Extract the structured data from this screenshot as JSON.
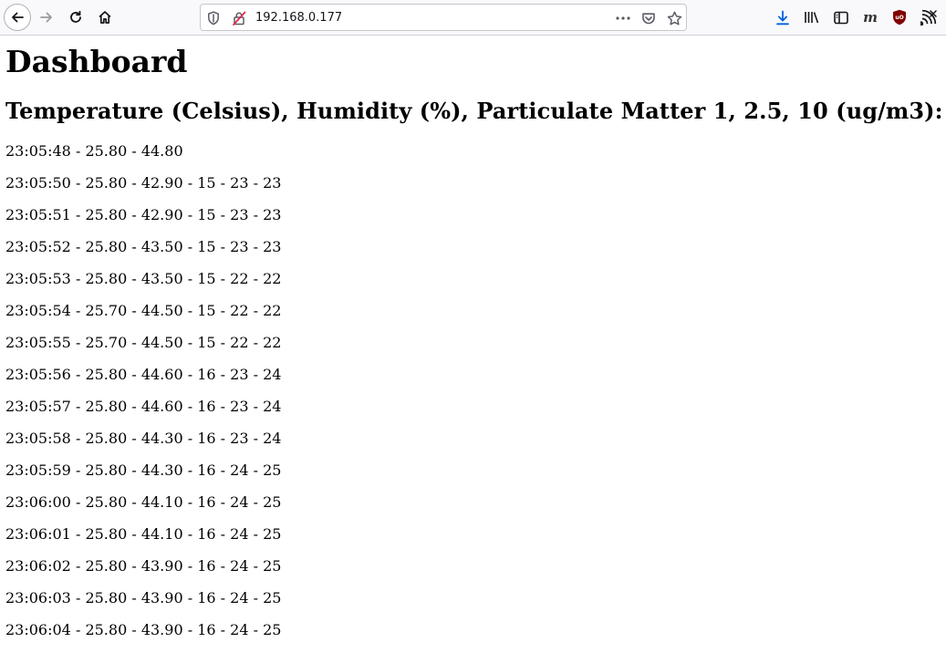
{
  "browser": {
    "url": "192.168.0.177"
  },
  "page": {
    "title": "Dashboard",
    "subtitle": "Temperature (Celsius), Humidity (%), Particulate Matter 1, 2.5, 10 (ug/m3):",
    "readings": [
      "23:05:48 - 25.80 - 44.80",
      "23:05:50 - 25.80 - 42.90 - 15 - 23 - 23",
      "23:05:51 - 25.80 - 42.90 - 15 - 23 - 23",
      "23:05:52 - 25.80 - 43.50 - 15 - 23 - 23",
      "23:05:53 - 25.80 - 43.50 - 15 - 22 - 22",
      "23:05:54 - 25.70 - 44.50 - 15 - 22 - 22",
      "23:05:55 - 25.70 - 44.50 - 15 - 22 - 22",
      "23:05:56 - 25.80 - 44.60 - 16 - 23 - 24",
      "23:05:57 - 25.80 - 44.60 - 16 - 23 - 24",
      "23:05:58 - 25.80 - 44.30 - 16 - 23 - 24",
      "23:05:59 - 25.80 - 44.30 - 16 - 24 - 25",
      "23:06:00 - 25.80 - 44.10 - 16 - 24 - 25",
      "23:06:01 - 25.80 - 44.10 - 16 - 24 - 25",
      "23:06:02 - 25.80 - 43.90 - 16 - 24 - 25",
      "23:06:03 - 25.80 - 43.90 - 16 - 24 - 25",
      "23:06:04 - 25.80 - 43.90 - 16 - 24 - 25"
    ]
  },
  "colors": {
    "toolbar_bg": "#f9f9fb",
    "download_accent": "#0060df",
    "ublock_red": "#800000",
    "insecure_red": "#e22850"
  }
}
